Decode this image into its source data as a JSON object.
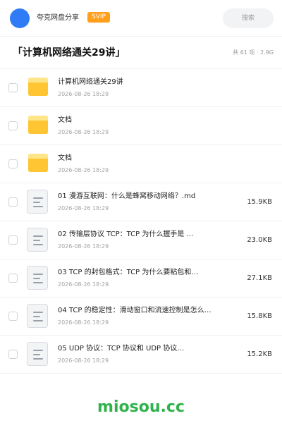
{
  "header": {
    "share_name": "夸克网盘分享",
    "vip_badge": "SVIP",
    "search_label": "搜索"
  },
  "folder": {
    "title": "「计算机网络通关29讲」",
    "summary": "共 61 项 · 2.9G"
  },
  "files": [
    {
      "type": "folder",
      "icon": "folder-icon",
      "name": "计算机网络通关29讲",
      "date": "2026-08-26 18:29",
      "size": ""
    },
    {
      "type": "folder",
      "icon": "folder-icon",
      "name": "文档",
      "date": "2026-08-26 18:29",
      "size": ""
    },
    {
      "type": "folder",
      "icon": "folder-icon",
      "name": "文档",
      "date": "2026-08-26 18:29",
      "size": ""
    },
    {
      "type": "file",
      "icon": "document-icon",
      "name": "01 漫游互联网：什么是蜂窝移动网络？.md",
      "date": "2026-08-26 18:29",
      "size": "15.9KB"
    },
    {
      "type": "file",
      "icon": "document-icon",
      "name": "02 传输层协议 TCP：TCP 为什么握手是 …",
      "date": "2026-08-26 18:29",
      "size": "23.0KB"
    },
    {
      "type": "file",
      "icon": "document-icon",
      "name": "03 TCP 的封包格式：TCP 为什么要粘包和…",
      "date": "2026-08-26 18:29",
      "size": "27.1KB"
    },
    {
      "type": "file",
      "icon": "document-icon",
      "name": "04 TCP 的稳定性：滑动窗口和流速控制是怎么…",
      "date": "2026-08-26 18:29",
      "size": "15.8KB"
    },
    {
      "type": "file",
      "icon": "document-icon",
      "name": "05 UDP 协议：TCP 协议和 UDP 协议…",
      "date": "2026-08-26 18:29",
      "size": "15.2KB"
    }
  ],
  "watermark": "miosou.cc",
  "colors": {
    "avatar": "#2f7cf6",
    "vip_badge": "#ff9f1c",
    "folder": "#ffc533",
    "watermark": "#2fb24a"
  }
}
